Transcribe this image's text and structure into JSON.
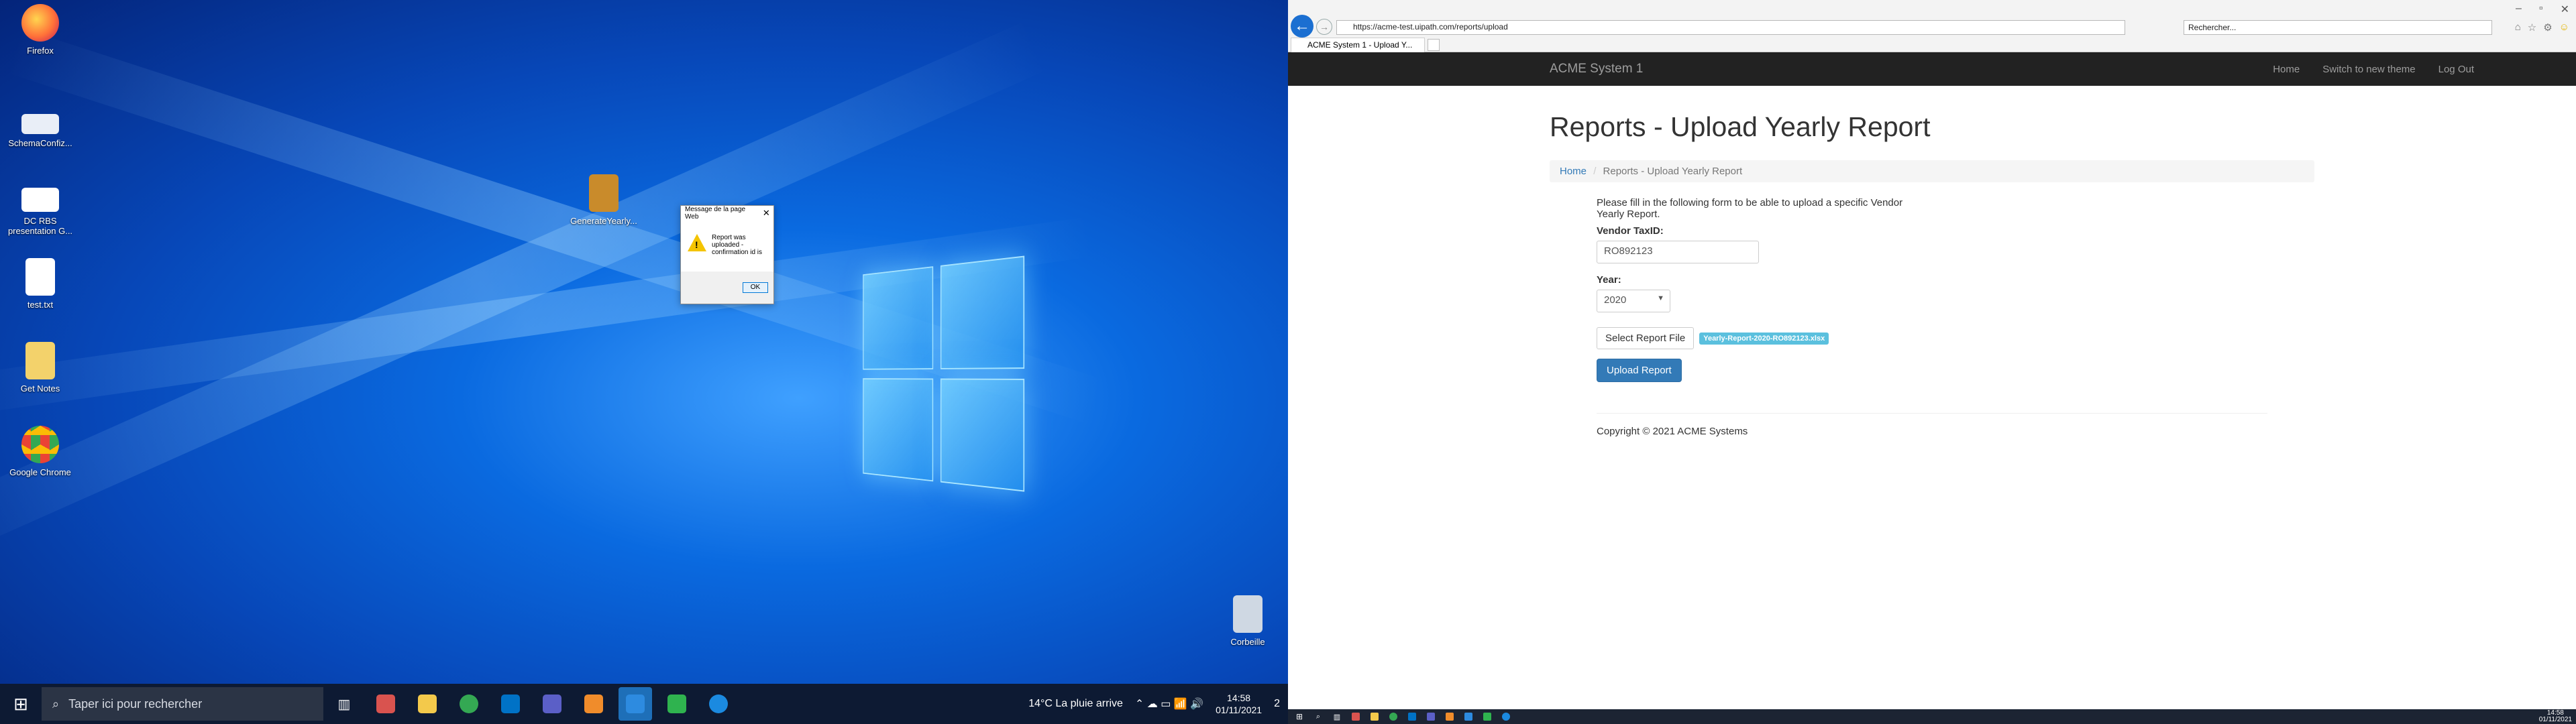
{
  "desktop": {
    "icons": [
      {
        "label": "Firefox",
        "color": "#ff7139"
      },
      {
        "label": "SchemaConfiz...",
        "color": "#e9eef7"
      },
      {
        "label": "DC RBS presentation G...",
        "color": "#ffffff"
      },
      {
        "label": "test.txt",
        "color": "#ffffff"
      },
      {
        "label": "Get Notes",
        "color": "#f3d26b"
      },
      {
        "label": "Google Chrome",
        "color": "#34a853"
      },
      {
        "label": "GenerateYearly...",
        "color": "#c98b2b"
      },
      {
        "label": "Corbeille",
        "color": "#cfd8e3"
      }
    ]
  },
  "taskbar": {
    "search_placeholder": "Taper ici pour rechercher",
    "weather": "14°C  La pluie arrive",
    "time": "14:58",
    "date": "01/11/2021",
    "notifications": "2"
  },
  "browser": {
    "url": "https://acme-test.uipath.com/reports/upload",
    "search_placeholder": "Rechercher...",
    "tab_title": "ACME System 1 - Upload Y..."
  },
  "site": {
    "brand": "ACME System 1",
    "nav": [
      "Home",
      "Switch to new theme",
      "Log Out"
    ],
    "title": "Reports - Upload Yearly Report",
    "breadcrumb_home": "Home",
    "breadcrumb_current": "Reports - Upload Yearly Report",
    "intro": "Please fill in the following form to be able to upload a specific Vendor Yearly Report.",
    "vendor_label": "Vendor TaxID:",
    "vendor_value": "RO892123",
    "year_label": "Year:",
    "year_value": "2020",
    "select_file_label": "Select Report File",
    "file_name": "Yearly-Report-2020-RO892123.xlsx",
    "upload_label": "Upload Report",
    "footer": "Copyright © 2021 ACME Systems"
  },
  "dialog": {
    "title": "Message de la page Web",
    "message": "Report was uploaded - confirmation id is",
    "ok_label": "OK"
  },
  "taskbar_right": {
    "time": "14:58",
    "date": "01/11/2021"
  }
}
